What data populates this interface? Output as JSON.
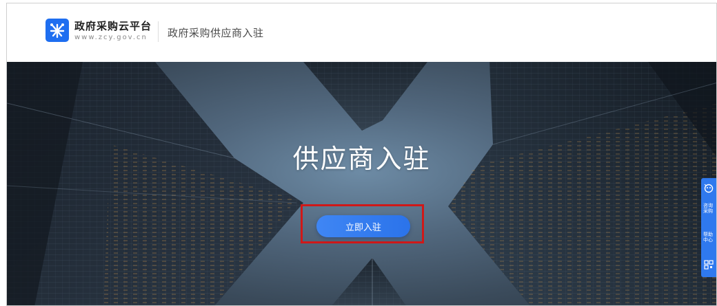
{
  "header": {
    "logo_title": "政府采购云平台",
    "logo_url": "www.zcy.gov.cn",
    "page_subtitle": "政府采购供应商入驻"
  },
  "hero": {
    "title": "供应商入驻",
    "join_button_label": "立即入驻"
  },
  "float_bar": {
    "items": [
      {
        "icon": "assistant-icon"
      },
      {
        "label": "咨询采购"
      },
      {
        "label": "帮助中心"
      },
      {
        "icon": "qrcode-icon"
      }
    ]
  },
  "colors": {
    "brand_blue": "#1e6ef0",
    "button_blue": "#2b73ea",
    "highlight_red": "#d01818",
    "hero_sky": "#6d8ba5"
  }
}
